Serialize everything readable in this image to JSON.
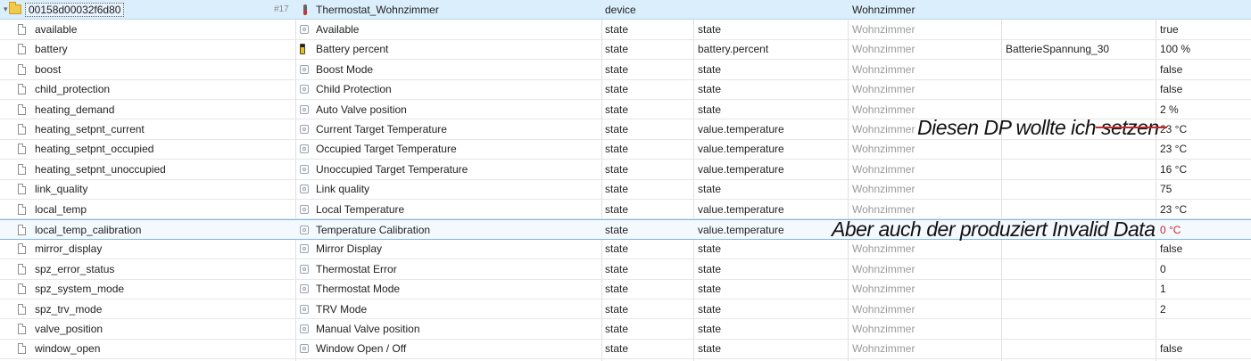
{
  "header": {
    "id": "00158d00032f6d80",
    "count": "#17",
    "name": "Thermostat_Wohnzimmer",
    "type": "device",
    "room": "Wohnzimmer"
  },
  "rows": [
    {
      "id": "available",
      "icon": "state-icon",
      "name": "Available",
      "type": "state",
      "role": "state",
      "room": "Wohnzimmer",
      "func": "",
      "value": "true"
    },
    {
      "id": "battery",
      "icon": "battery-icon",
      "name": "Battery percent",
      "type": "state",
      "role": "battery.percent",
      "room": "Wohnzimmer",
      "func": "BatterieSpannung_30",
      "value": "100 %"
    },
    {
      "id": "boost",
      "icon": "state-icon",
      "name": "Boost Mode",
      "type": "state",
      "role": "state",
      "room": "Wohnzimmer",
      "func": "",
      "value": "false"
    },
    {
      "id": "child_protection",
      "icon": "state-icon",
      "name": "Child Protection",
      "type": "state",
      "role": "state",
      "room": "Wohnzimmer",
      "func": "",
      "value": "false"
    },
    {
      "id": "heating_demand",
      "icon": "state-icon",
      "name": "Auto Valve position",
      "type": "state",
      "role": "state",
      "room": "Wohnzimmer",
      "func": "",
      "value": "2 %"
    },
    {
      "id": "heating_setpnt_current",
      "icon": "state-icon",
      "name": "Current Target Temperature",
      "type": "state",
      "role": "value.temperature",
      "room": "Wohnzimmer",
      "func": "",
      "value": "23 °C"
    },
    {
      "id": "heating_setpnt_occupied",
      "icon": "state-icon",
      "name": "Occupied Target Temperature",
      "type": "state",
      "role": "value.temperature",
      "room": "Wohnzimmer",
      "func": "",
      "value": "23 °C"
    },
    {
      "id": "heating_setpnt_unoccupied",
      "icon": "state-icon",
      "name": "Unoccupied Target Temperature",
      "type": "state",
      "role": "value.temperature",
      "room": "Wohnzimmer",
      "func": "",
      "value": "16 °C"
    },
    {
      "id": "link_quality",
      "icon": "state-icon",
      "name": "Link quality",
      "type": "state",
      "role": "state",
      "room": "Wohnzimmer",
      "func": "",
      "value": "75"
    },
    {
      "id": "local_temp",
      "icon": "state-icon",
      "name": "Local Temperature",
      "type": "state",
      "role": "value.temperature",
      "room": "Wohnzimmer",
      "func": "",
      "value": "23 °C"
    },
    {
      "id": "local_temp_calibration",
      "icon": "state-icon",
      "name": "Temperature Calibration",
      "type": "state",
      "role": "value.temperature",
      "room": "",
      "func": "",
      "value": "0 °C",
      "value_color": "#c62828",
      "selected": true
    },
    {
      "id": "mirror_display",
      "icon": "state-icon",
      "name": "Mirror Display",
      "type": "state",
      "role": "state",
      "room": "Wohnzimmer",
      "func": "",
      "value": "false"
    },
    {
      "id": "spz_error_status",
      "icon": "state-icon",
      "name": "Thermostat Error",
      "type": "state",
      "role": "state",
      "room": "Wohnzimmer",
      "func": "",
      "value": "0"
    },
    {
      "id": "spz_system_mode",
      "icon": "state-icon",
      "name": "Thermostat Mode",
      "type": "state",
      "role": "state",
      "room": "Wohnzimmer",
      "func": "",
      "value": "1"
    },
    {
      "id": "spz_trv_mode",
      "icon": "state-icon",
      "name": "TRV Mode",
      "type": "state",
      "role": "state",
      "room": "Wohnzimmer",
      "func": "",
      "value": "2"
    },
    {
      "id": "valve_position",
      "icon": "state-icon",
      "name": "Manual Valve position",
      "type": "state",
      "role": "state",
      "room": "Wohnzimmer",
      "func": "",
      "value": ""
    },
    {
      "id": "window_open",
      "icon": "state-icon",
      "name": "Window Open / Off",
      "type": "state",
      "role": "state",
      "room": "Wohnzimmer",
      "func": "",
      "value": "false"
    }
  ],
  "annotations": {
    "note1": "Diesen DP wollte ich setzen",
    "note2": "Aber auch der produziert Invalid Data"
  },
  "colors": {
    "header_bg": "#dbeefc",
    "error_value": "#c62828",
    "room_text": "#9a9a9a"
  }
}
